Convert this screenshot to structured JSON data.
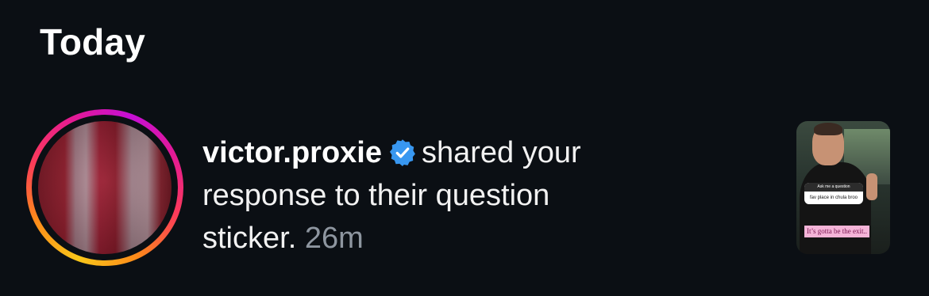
{
  "section": {
    "title": "Today"
  },
  "notification": {
    "username": "victor.proxie",
    "verified": true,
    "message": "shared your response to their question sticker.",
    "time": "26m",
    "thumbnail": {
      "sticker_header": "Ask me a question",
      "sticker_question": "fav place in chula broo",
      "answer": "It’s gotta be the exit.."
    }
  },
  "colors": {
    "background": "#0b0f14",
    "verified_badge": "#3897f0",
    "timestamp": "#8e96a0",
    "story_ring": [
      "#f9c71a",
      "#fd8a1a",
      "#fb3a5a",
      "#e41a94",
      "#c50fd5"
    ]
  },
  "icons": {
    "verified": "verified-badge-icon"
  }
}
